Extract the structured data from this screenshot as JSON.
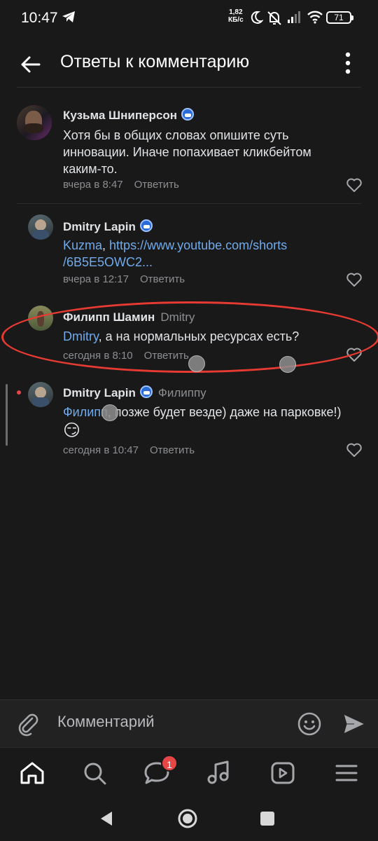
{
  "status_bar": {
    "time": "10:47",
    "net_speed_value": "1,82",
    "net_speed_unit": "КБ/с",
    "battery": "71"
  },
  "header": {
    "title": "Ответы к комментарию"
  },
  "comments": [
    {
      "author": "Кузьма Шниперсон",
      "reply_to": "",
      "text_lines": [
        "Хотя бы в общих словах опишите суть",
        "инновации. Иначе попахивает кликбейтом",
        "каким-то."
      ],
      "time": "вчера в 8:47",
      "reply_label": "Ответить"
    },
    {
      "author": "Dmitry Lapin",
      "reply_to": "",
      "mention": "Kuzma",
      "text_after_mention": ", ",
      "url_line1": "https://www.youtube.com/shorts",
      "url_line2": "/6B5E5OWC2...",
      "time": "вчера в 12:17",
      "reply_label": "Ответить"
    },
    {
      "author": "Филипп Шамин",
      "reply_to": "Dmitry",
      "mention": "Dmitry",
      "text_after_mention": ", а на нормальных ресурсах есть?",
      "time": "сегодня в 8:10",
      "reply_label": "Ответить"
    },
    {
      "author": "Dmitry Lapin",
      "reply_to": "Филиппу",
      "mention": "Филипп",
      "text_after_mention": ", позже будет везде) даже на парковке!)",
      "emoji": "😏",
      "time": "сегодня в 10:47",
      "reply_label": "Ответить"
    }
  ],
  "composer": {
    "placeholder": "Комментарий"
  },
  "bottom_nav": {
    "items": [
      "home-icon",
      "search-icon",
      "messages-icon",
      "music-icon",
      "video-icon",
      "menu-icon"
    ],
    "messages_badge": "1"
  },
  "colors": {
    "background": "#191919",
    "link": "#71aaeb",
    "annotation": "#e63a32",
    "badge": "#e64646"
  }
}
